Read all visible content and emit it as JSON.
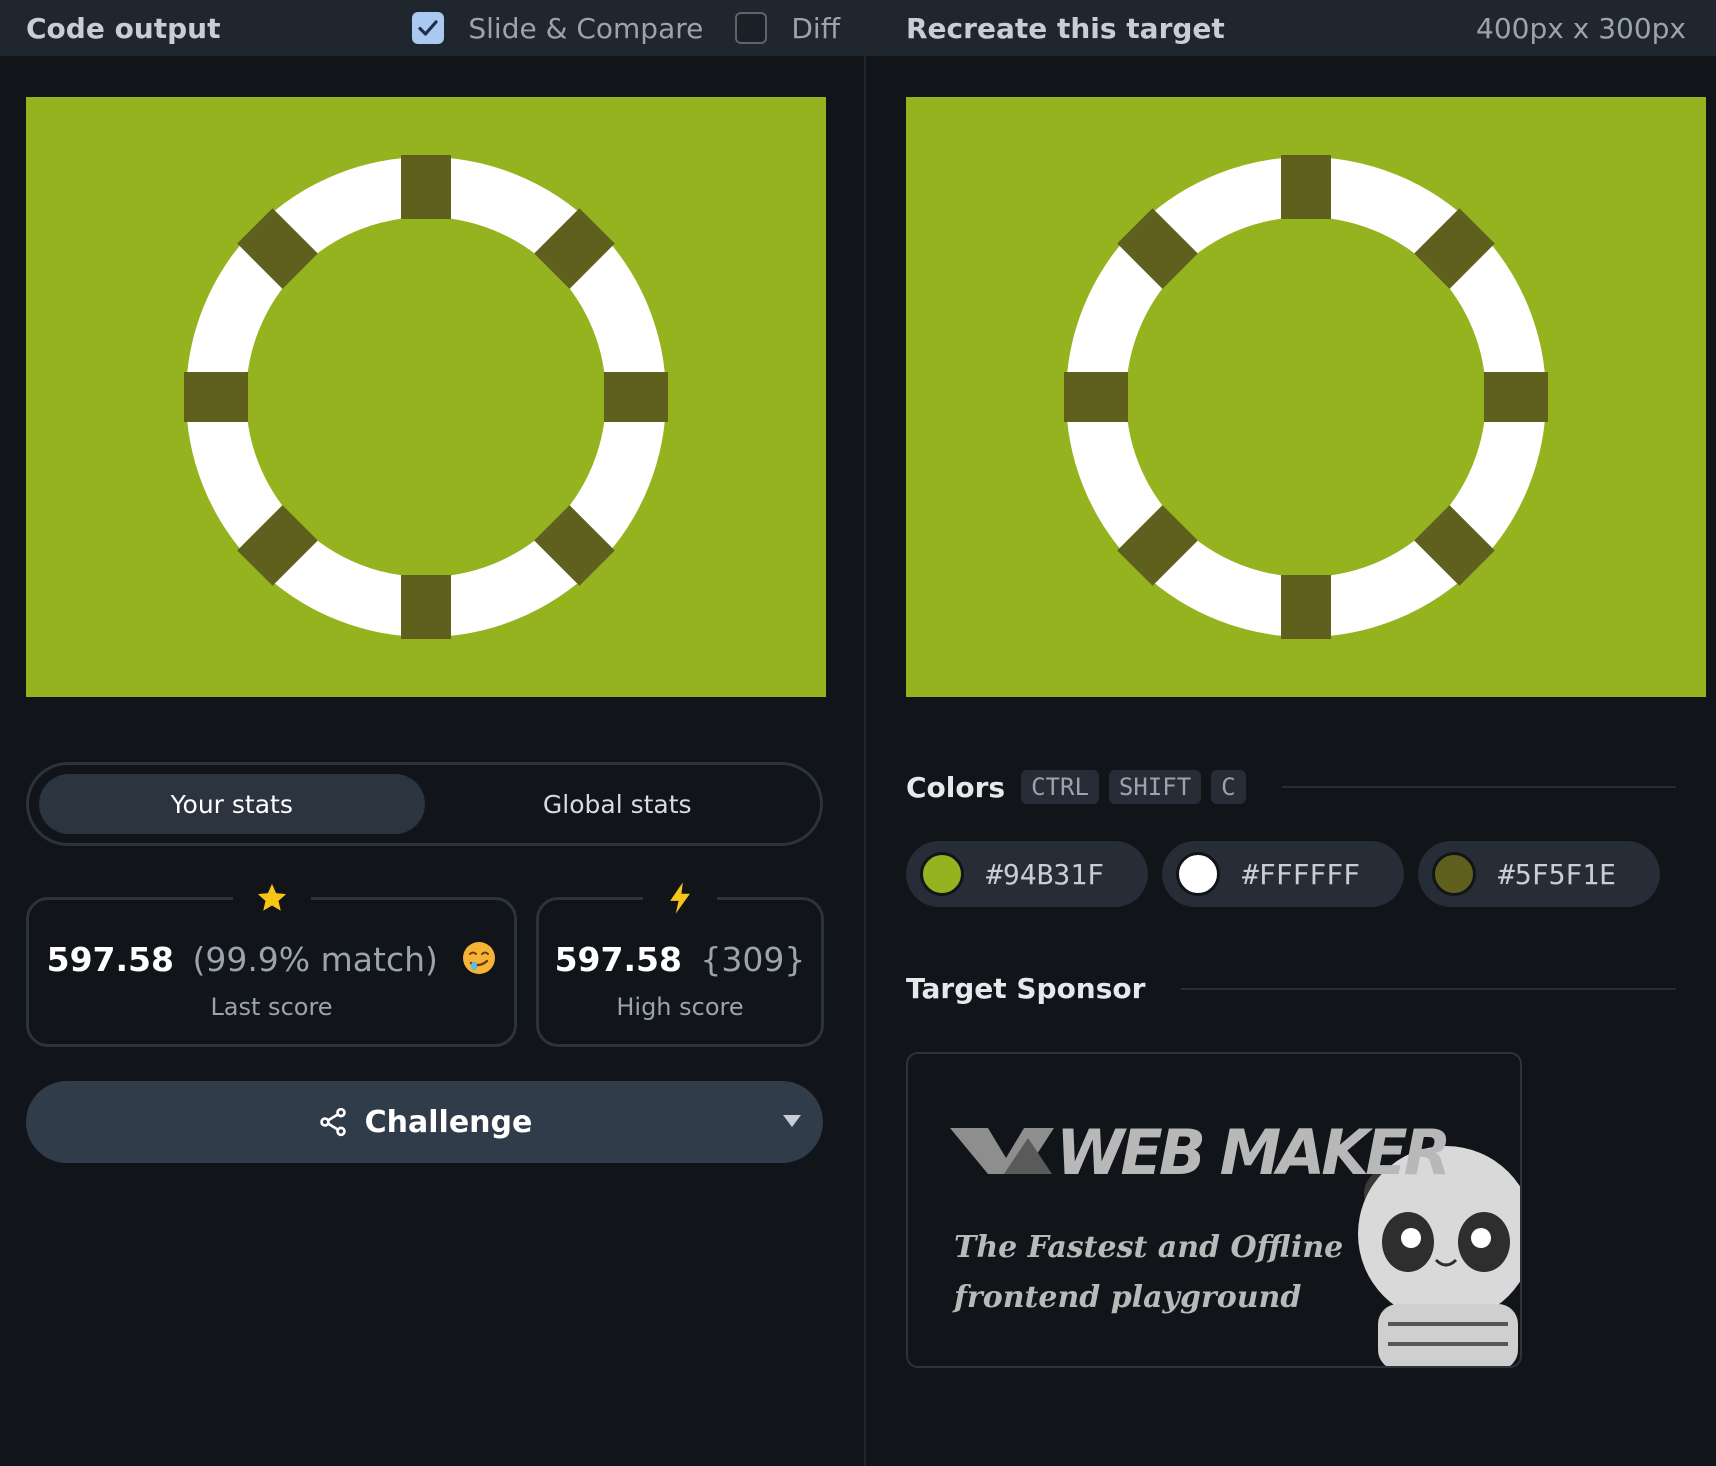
{
  "left": {
    "title": "Code output",
    "slide_compare": {
      "label": "Slide & Compare",
      "checked": true
    },
    "diff": {
      "label": "Diff",
      "checked": false
    }
  },
  "right": {
    "title": "Recreate this target",
    "size": "400px x 300px"
  },
  "stats": {
    "tabs": [
      {
        "label": "Your stats",
        "active": true
      },
      {
        "label": "Global stats",
        "active": false
      }
    ],
    "last": {
      "value": "597.58",
      "extra": "(99.9% match)",
      "caption": "Last score",
      "icon": "star-icon",
      "emoji": "drooling-face-emoji"
    },
    "high": {
      "value": "597.58",
      "extra": "{309}",
      "caption": "High score",
      "icon": "lightning-icon"
    }
  },
  "challenge": {
    "label": "Challenge",
    "icon": "share-icon"
  },
  "colors": {
    "title": "Colors",
    "shortcut": [
      "CTRL",
      "SHIFT",
      "C"
    ],
    "swatches": [
      {
        "hex": "#94B31F"
      },
      {
        "hex": "#FFFFFF"
      },
      {
        "hex": "#5F5F1E"
      }
    ]
  },
  "sponsor": {
    "title": "Target Sponsor",
    "brand": "WEB MAKER",
    "tagline_line1": "The Fastest and Offline",
    "tagline_line2": "frontend playground"
  },
  "theme": {
    "bg": "#111418",
    "canvas_bg": "#94B31F",
    "ring": "#FFFFFF",
    "band": "#5F5F1E",
    "accent_yellow": "#F5C518"
  }
}
